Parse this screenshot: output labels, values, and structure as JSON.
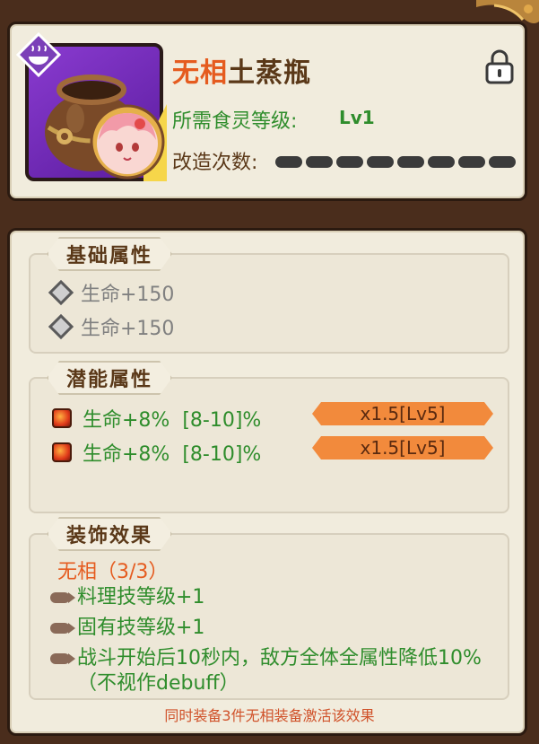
{
  "item": {
    "name_accent": "无相",
    "name_rest": "土蒸瓶",
    "required_label": "所需食灵等级:",
    "required_value": "Lv1",
    "modify_label": "改造次数:",
    "modify_pips_filled": 0,
    "modify_pips_total": 8,
    "icon": "clay-steamer-pot-icon",
    "badge_icon": "steam-bowl-icon",
    "lock_icon": "lock-icon",
    "avatar_icon": "pink-hair-girl-avatar"
  },
  "basic_attributes": {
    "title": "基础属性",
    "rows": [
      {
        "text": "生命+150"
      },
      {
        "text": "生命+150"
      }
    ]
  },
  "potential_attributes": {
    "title": "潜能属性",
    "rows": [
      {
        "text": "生命+8%  [8-10]%",
        "multiplier": "x1.5[Lv5]"
      },
      {
        "text": "生命+8%  [8-10]%",
        "multiplier": "x1.5[Lv5]"
      }
    ]
  },
  "set_effect": {
    "title": "装饰效果",
    "set_name": "无相（3/3）",
    "effects": [
      {
        "text": "料理技等级+1"
      },
      {
        "text": "固有技等级+1"
      },
      {
        "text": "战斗开始后10秒内，敌方全体全属性降低10%（不视作debuff）"
      }
    ],
    "footer": "同时装备3件无相装备激活该效果"
  },
  "colors": {
    "accent_orange": "#e55b1f",
    "green_text": "#2f8d2c",
    "panel_bg": "#f1ecdd",
    "frame_brown": "#4a2d1c",
    "multiplier_orange": "#f28a3c",
    "icon_purple": "#8a3bd0"
  }
}
